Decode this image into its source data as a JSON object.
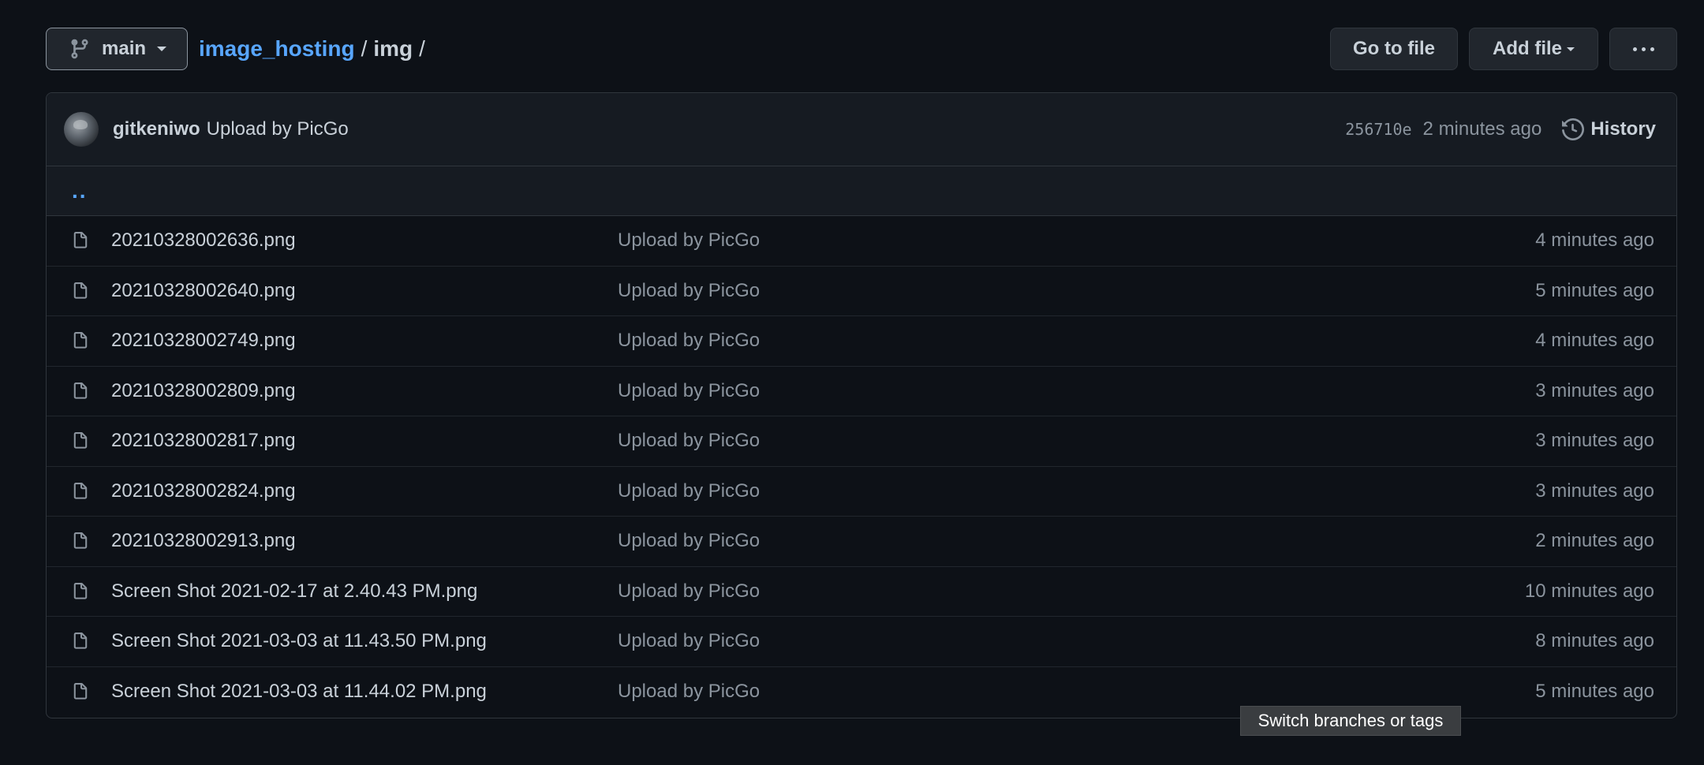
{
  "branch": {
    "label": "main"
  },
  "breadcrumb": {
    "repo": "image_hosting",
    "sep1": "/",
    "dir": "img",
    "sep2": "/"
  },
  "actions": {
    "go_to_file": "Go to file",
    "add_file": "Add file"
  },
  "latest_commit": {
    "author": "gitkeniwo",
    "message": "Upload by PicGo",
    "sha": "256710e",
    "time": "2 minutes ago",
    "history_label": "History"
  },
  "parent_dir": "..",
  "files": [
    {
      "name": "20210328002636.png",
      "message": "Upload by PicGo",
      "time": "4 minutes ago"
    },
    {
      "name": "20210328002640.png",
      "message": "Upload by PicGo",
      "time": "5 minutes ago"
    },
    {
      "name": "20210328002749.png",
      "message": "Upload by PicGo",
      "time": "4 minutes ago"
    },
    {
      "name": "20210328002809.png",
      "message": "Upload by PicGo",
      "time": "3 minutes ago"
    },
    {
      "name": "20210328002817.png",
      "message": "Upload by PicGo",
      "time": "3 minutes ago"
    },
    {
      "name": "20210328002824.png",
      "message": "Upload by PicGo",
      "time": "3 minutes ago"
    },
    {
      "name": "20210328002913.png",
      "message": "Upload by PicGo",
      "time": "2 minutes ago"
    },
    {
      "name": "Screen Shot 2021-02-17 at 2.40.43 PM.png",
      "message": "Upload by PicGo",
      "time": "10 minutes ago"
    },
    {
      "name": "Screen Shot 2021-03-03 at 11.43.50 PM.png",
      "message": "Upload by PicGo",
      "time": "8 minutes ago"
    },
    {
      "name": "Screen Shot 2021-03-03 at 11.44.02 PM.png",
      "message": "Upload by PicGo",
      "time": "5 minutes ago"
    }
  ],
  "tooltip": "Switch branches or tags",
  "colors": {
    "link": "#58a6ff",
    "background": "#0d1117",
    "header": "#161b22",
    "border": "#30363d"
  }
}
